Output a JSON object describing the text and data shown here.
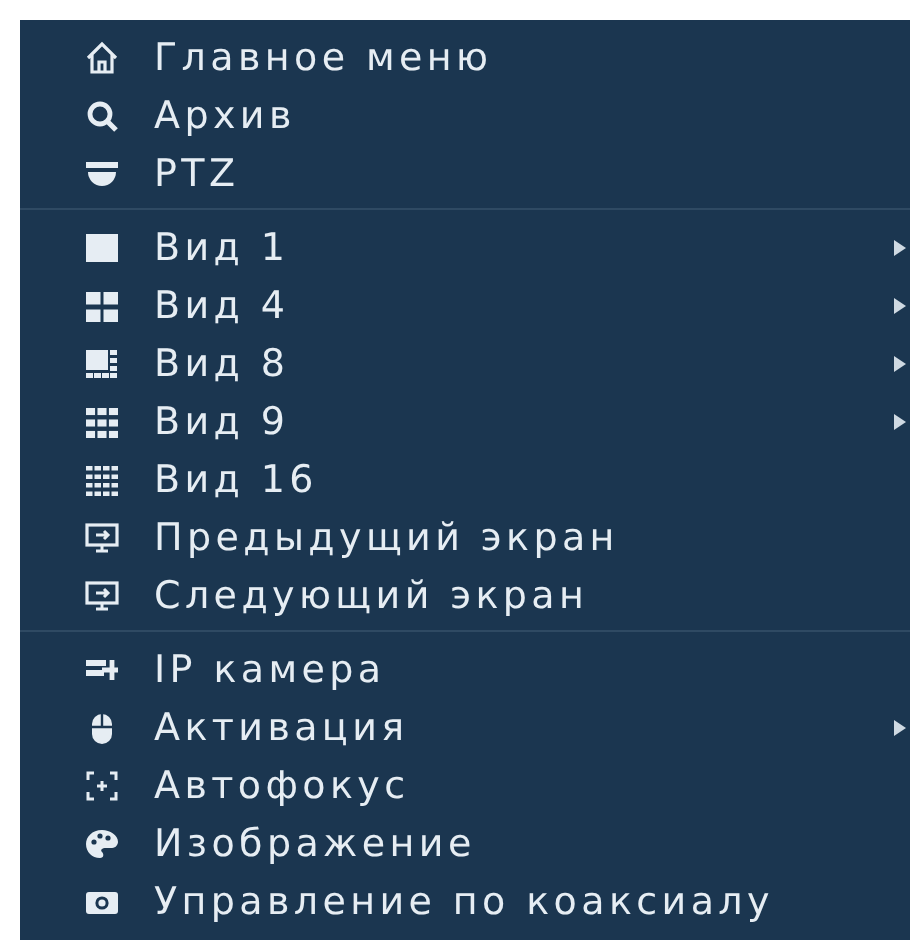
{
  "menu": {
    "groups": [
      {
        "items": [
          {
            "kind": "home",
            "label": "Главное меню",
            "submenu": false
          },
          {
            "kind": "search",
            "label": "Архив",
            "submenu": false
          },
          {
            "kind": "dome",
            "label": "PTZ",
            "submenu": false
          }
        ]
      },
      {
        "items": [
          {
            "kind": "view1",
            "label": "Вид 1",
            "submenu": true
          },
          {
            "kind": "view4",
            "label": "Вид 4",
            "submenu": true
          },
          {
            "kind": "view8",
            "label": "Вид 8",
            "submenu": true
          },
          {
            "kind": "view9",
            "label": "Вид 9",
            "submenu": true
          },
          {
            "kind": "view16",
            "label": "Вид 16",
            "submenu": false
          },
          {
            "kind": "screen",
            "label": "Предыдущий экран",
            "submenu": false
          },
          {
            "kind": "screen",
            "label": "Следующий экран",
            "submenu": false
          }
        ]
      },
      {
        "items": [
          {
            "kind": "ipcam",
            "label": "IP камера",
            "submenu": false
          },
          {
            "kind": "activation",
            "label": "Активация",
            "submenu": true
          },
          {
            "kind": "focus",
            "label": "Автофокус",
            "submenu": false
          },
          {
            "kind": "palette",
            "label": "Изображение",
            "submenu": false
          },
          {
            "kind": "camera",
            "label": "Управление по коаксиалу",
            "submenu": false
          }
        ]
      }
    ]
  }
}
